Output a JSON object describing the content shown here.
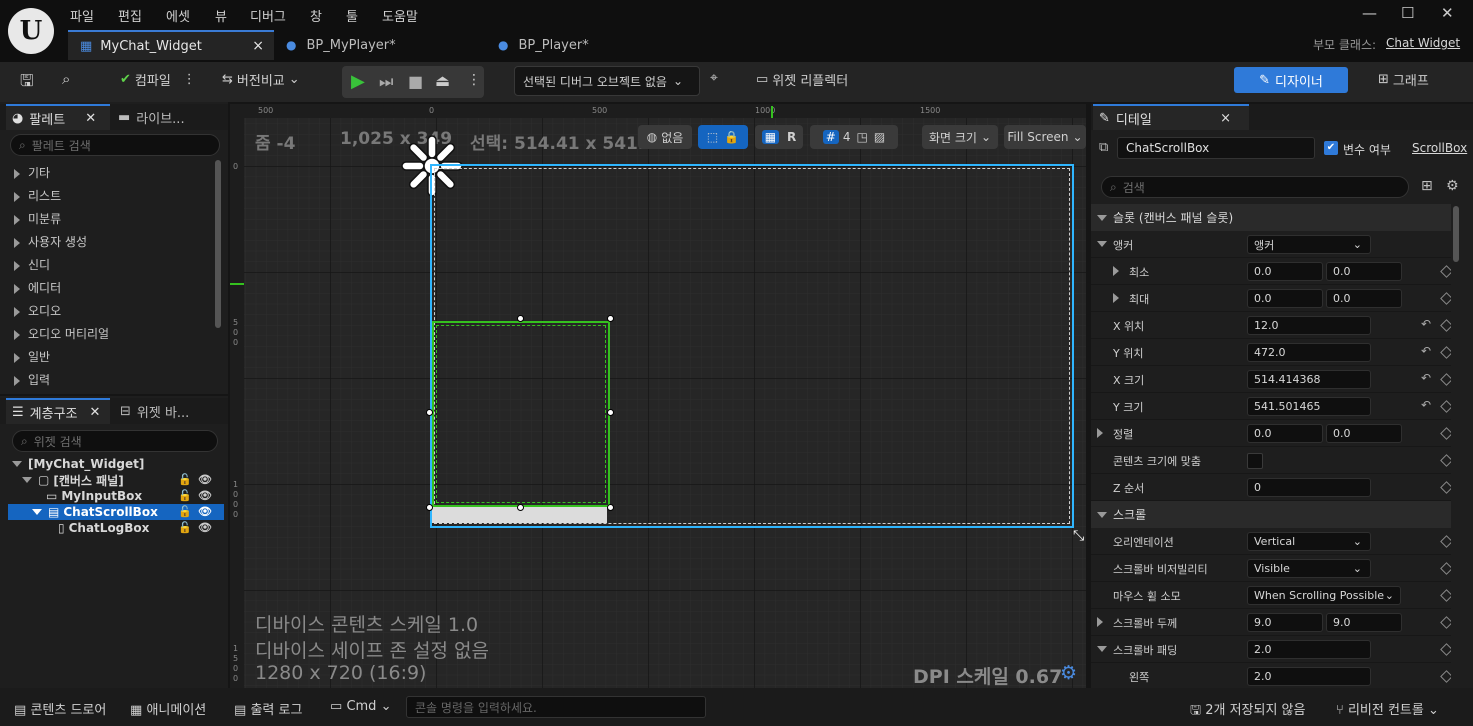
{
  "menu": [
    "파일",
    "편집",
    "에셋",
    "뷰",
    "디버그",
    "창",
    "툴",
    "도움말"
  ],
  "tabs": [
    {
      "label": "MyChat_Widget",
      "close": "×"
    },
    {
      "label": "BP_MyPlayer*"
    },
    {
      "label": "BP_Player*"
    }
  ],
  "parent_class": {
    "label": "부모 클래스:",
    "value": "Chat Widget"
  },
  "toolbar": {
    "compile": "컴파일",
    "diff": "버전비교",
    "debug_object": "선택된 디버그 오브젝트 없음",
    "reflector": "위젯 리플렉터",
    "designer": "디자이너",
    "graph": "그래프"
  },
  "palette": {
    "tab": "팔레트",
    "tab2": "라이브...",
    "search": "팔레트 검색",
    "items": [
      "기타",
      "리스트",
      "미분류",
      "사용자 생성",
      "신디",
      "에디터",
      "오디오",
      "오디오 머티리얼",
      "일반",
      "입력"
    ]
  },
  "hierarchy": {
    "tab": "계층구조",
    "tab2": "위젯 바...",
    "search": "위젯 검색",
    "items": [
      "[MyChat_Widget]",
      "[캔버스 패널]",
      "MyInputBox",
      "ChatScrollBox",
      "ChatLogBox"
    ]
  },
  "viewport": {
    "zoom": "줌 -4",
    "size": "1,025 x 349",
    "selection": "선택: 514.41 x 541.5",
    "none": "없음",
    "r": "R",
    "grid": "4",
    "screen_size": "화면 크기",
    "fill": "Fill Screen",
    "ruler": [
      "500",
      "0",
      "500",
      "1000",
      "1500"
    ],
    "vruler": [
      "0",
      "5",
      "0",
      "0",
      "1",
      "0",
      "0",
      "0",
      "1",
      "5",
      "0",
      "0"
    ],
    "info1": "디바이스 콘텐츠 스케일 1.0",
    "info2": "디바이스 세이프 존 설정 없음",
    "info3": "1280 x 720 (16:9)",
    "dpi": "DPI 스케일 0.67"
  },
  "details": {
    "tab": "디테일",
    "close": "×",
    "name": "ChatScrollBox",
    "var_label": "변수 여부",
    "class_link": "ScrollBox",
    "search": "검색",
    "slot_section": "슬롯 (캔버스 패널 슬롯)",
    "anchor": "앵커",
    "anchor_value": "앵커",
    "min": "최소",
    "min_x": "0.0",
    "min_y": "0.0",
    "max": "최대",
    "max_x": "0.0",
    "max_y": "0.0",
    "xpos": "X 위치",
    "xpos_v": "12.0",
    "ypos": "Y 위치",
    "ypos_v": "472.0",
    "xsize": "X 크기",
    "xsize_v": "514.414368",
    "ysize": "Y 크기",
    "ysize_v": "541.501465",
    "align": "정렬",
    "align_x": "0.0",
    "align_y": "0.0",
    "fit": "콘텐츠 크기에 맞춤",
    "zorder": "Z 순서",
    "zorder_v": "0",
    "scroll_section": "스크롤",
    "orient": "오리엔테이션",
    "orient_v": "Vertical",
    "sbvis": "스크롤바 비저빌리티",
    "sbvis_v": "Visible",
    "wheel": "마우스 휠 소모",
    "wheel_v": "When Scrolling Possible",
    "thick": "스크롤바 두께",
    "thick_x": "9.0",
    "thick_y": "9.0",
    "pad": "스크롤바 패딩",
    "pad_v": "2.0",
    "left": "왼쪽",
    "left_v": "2.0"
  },
  "bottom": {
    "drawer": "콘텐츠 드로어",
    "anim": "애니메이션",
    "log": "출력 로그",
    "cmd": "Cmd",
    "console": "콘솔 명령을 입력하세요.",
    "unsaved": "2개 저장되지 않음",
    "revision": "리비전 컨트롤"
  },
  "colors": {
    "accent": "#2f7ad9",
    "select": "#1565c0",
    "green": "#35c11f",
    "cyan": "#2fb6ff"
  }
}
